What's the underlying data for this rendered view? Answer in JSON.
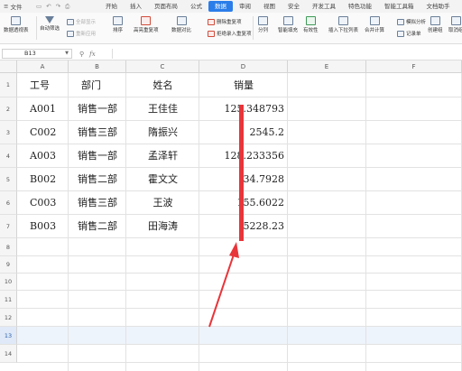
{
  "menubar": {
    "file_label": "文件",
    "tabs": [
      {
        "label": "开始",
        "active": false
      },
      {
        "label": "插入",
        "active": false
      },
      {
        "label": "页面布局",
        "active": false
      },
      {
        "label": "公式",
        "active": false
      },
      {
        "label": "数据",
        "active": true
      },
      {
        "label": "审阅",
        "active": false
      },
      {
        "label": "视图",
        "active": false
      },
      {
        "label": "安全",
        "active": false
      },
      {
        "label": "开发工具",
        "active": false
      },
      {
        "label": "特色功能",
        "active": false
      },
      {
        "label": "智能工具箱",
        "active": false
      },
      {
        "label": "文档助手",
        "active": false
      }
    ],
    "active_color": "#2b7de9"
  },
  "ribbon": {
    "pivot": "数据透视表",
    "autofilter": "自动筛选",
    "show_all": "全部显示",
    "reapply": "重新应用",
    "sort": "排序",
    "highlight_dup": "高亮重复项",
    "data_compare": "数据对比",
    "remove_dup": "删除重复项",
    "reject_dup": "拒绝录入重复项",
    "split": "分列",
    "smart_fill": "智能填充",
    "validity": "有效性",
    "dropdown": "插入下拉列表",
    "consolidate": "合并计算",
    "simulate": "模拟分析",
    "record": "记录单",
    "group": "创建组",
    "ungroup": "取消组"
  },
  "formula_bar": {
    "name_box": "B13",
    "fx_label": "fx",
    "formula": ""
  },
  "columns": [
    "A",
    "B",
    "C",
    "D",
    "E",
    "F"
  ],
  "rows": [
    "1",
    "2",
    "3",
    "4",
    "5",
    "6",
    "7",
    "8",
    "9",
    "10",
    "11",
    "12",
    "13",
    "14"
  ],
  "selected_row": "13",
  "table": {
    "headers": [
      "工号",
      "部门",
      "姓名",
      "销量"
    ],
    "rows": [
      [
        "A001",
        "销售一部",
        "王佳佳",
        "125.348793"
      ],
      [
        "C002",
        "销售三部",
        "隋振兴",
        "2545.2"
      ],
      [
        "A003",
        "销售一部",
        "孟泽轩",
        "128.233356"
      ],
      [
        "B002",
        "销售二部",
        "霍文文",
        "34.7928"
      ],
      [
        "C003",
        "销售三部",
        "王波",
        "155.6022"
      ],
      [
        "B003",
        "销售二部",
        "田海涛",
        "5228.23"
      ]
    ]
  },
  "annotation_color": "#e8353a"
}
